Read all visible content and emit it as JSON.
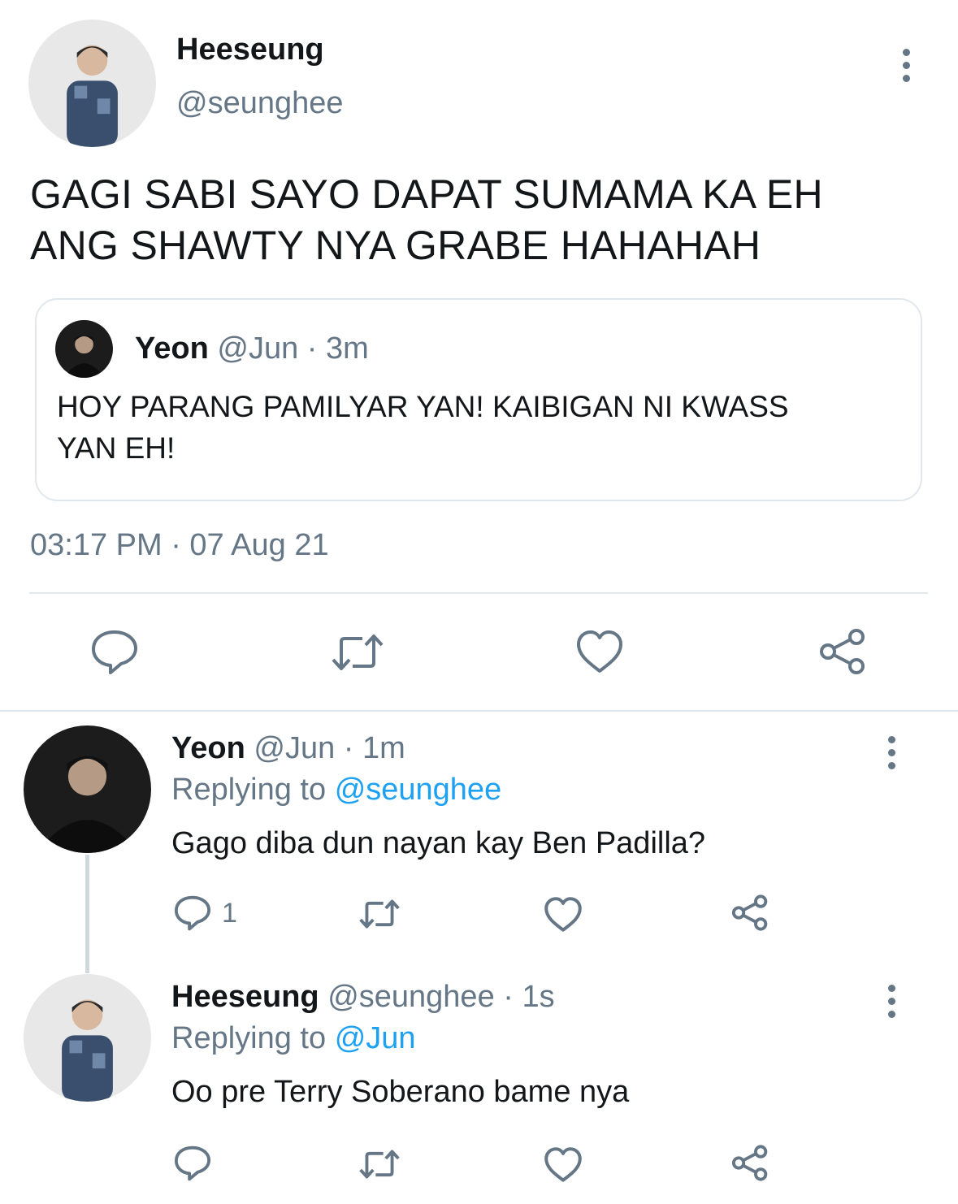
{
  "main_tweet": {
    "author_name": "Heeseung",
    "author_handle": "@seunghee",
    "text_line1": "GAGI SABI SAYO DAPAT SUMAMA KA EH",
    "text_line2": "ANG SHAWTY NYA GRABE HAHAHAH",
    "quoted": {
      "author_name": "Yeon",
      "author_handle": "@Jun",
      "time": "· 3m",
      "text_line1": "HOY PARANG PAMILYAR YAN! KAIBIGAN NI KWASS",
      "text_line2": "YAN EH!"
    },
    "timestamp": "03:17 PM · 07 Aug 21",
    "actions": [
      "reply-icon",
      "retweet-icon",
      "like-icon",
      "share-icon"
    ]
  },
  "replies": [
    {
      "author_name": "Yeon",
      "author_handle": "@Jun",
      "time": "· 1m",
      "replying_prefix": "Replying to",
      "replying_to": "@seunghee",
      "text": "Gago diba dun nayan kay Ben Padilla?",
      "reply_count": "1"
    },
    {
      "author_name": "Heeseung",
      "author_handle": "@seunghee",
      "time": "· 1s",
      "replying_prefix": "Replying to",
      "replying_to": "@Jun",
      "text": "Oo pre Terry Soberano bame nya",
      "reply_count": ""
    }
  ],
  "colors": {
    "text": "#14171a",
    "muted": "#657786",
    "link": "#1da1f2",
    "border": "#e1e8ed"
  }
}
